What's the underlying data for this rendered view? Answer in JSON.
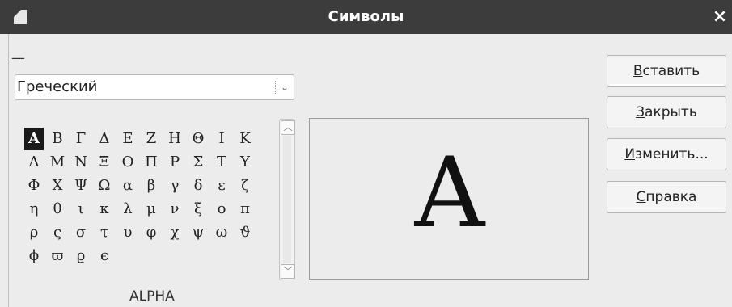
{
  "window": {
    "title": "Символы",
    "close_label": "×"
  },
  "subset": {
    "dash": "—",
    "selected": "Греческий"
  },
  "symbols": [
    [
      "Α",
      "Β",
      "Γ",
      "Δ",
      "Ε",
      "Ζ",
      "Η",
      "Θ",
      "Ι",
      "Κ"
    ],
    [
      "Λ",
      "Μ",
      "Ν",
      "Ξ",
      "Ο",
      "Π",
      "Ρ",
      "Σ",
      "Τ",
      "Υ"
    ],
    [
      "Φ",
      "Χ",
      "Ψ",
      "Ω",
      "α",
      "β",
      "γ",
      "δ",
      "ε",
      "ζ"
    ],
    [
      "η",
      "θ",
      "ι",
      "κ",
      "λ",
      "μ",
      "ν",
      "ξ",
      "ο",
      "π"
    ],
    [
      "ρ",
      "ς",
      "σ",
      "τ",
      "υ",
      "φ",
      "χ",
      "ψ",
      "ω",
      "ϑ"
    ],
    [
      "ϕ",
      "ϖ",
      "ϱ",
      "ϵ"
    ]
  ],
  "selected_symbol": {
    "glyph": "Α",
    "name": "ALPHA"
  },
  "buttons": {
    "insert": {
      "accel": "В",
      "rest": "ставить"
    },
    "close": {
      "accel": "З",
      "rest": "акрыть"
    },
    "modify": {
      "accel": "И",
      "rest": "зменить..."
    },
    "help": {
      "accel": "С",
      "rest": "правка"
    }
  }
}
